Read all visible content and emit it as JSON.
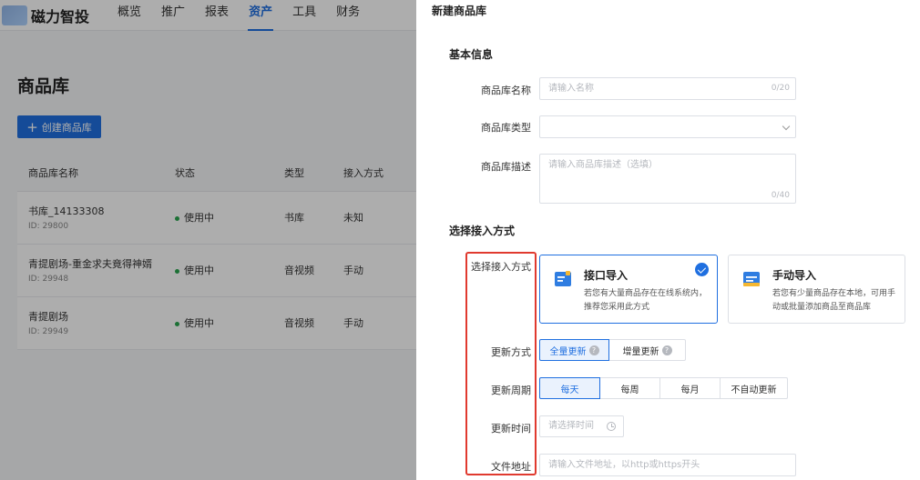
{
  "app": {
    "brand": "磁力智投",
    "nav": [
      "概览",
      "推广",
      "报表",
      "资产",
      "工具",
      "财务"
    ],
    "active_nav": "资产"
  },
  "page": {
    "title": "商品库",
    "create_button": "创建商品库",
    "columns": [
      "商品库名称",
      "状态",
      "类型",
      "接入方式"
    ],
    "rows": [
      {
        "name": "书库_14133308",
        "id": "ID: 29800",
        "status": "使用中",
        "type": "书库",
        "method": "未知"
      },
      {
        "name": "青提剧场-重金求夫竟得神婿",
        "id": "ID: 29948",
        "status": "使用中",
        "type": "音视频",
        "method": "手动"
      },
      {
        "name": "青提剧场",
        "id": "ID: 29949",
        "status": "使用中",
        "type": "音视频",
        "method": "手动"
      }
    ]
  },
  "drawer": {
    "title": "新建商品库",
    "basic_section": "基本信息",
    "name_label": "商品库名称",
    "name_placeholder": "请输入名称",
    "name_counter": "0/20",
    "type_label": "商品库类型",
    "desc_label": "商品库描述",
    "desc_placeholder": "请输入商品库描述（选填）",
    "desc_counter": "0/40",
    "access_section": "选择接入方式",
    "access_label": "选择接入方式",
    "cards": [
      {
        "title": "接口导入",
        "desc": "若您有大量商品存在在线系统内，推荐您采用此方式",
        "selected": true
      },
      {
        "title": "手动导入",
        "desc": "若您有少量商品存在本地，可用手动或批量添加商品至商品库",
        "selected": false
      }
    ],
    "update_mode_label": "更新方式",
    "update_modes": [
      "全量更新",
      "增量更新"
    ],
    "cycle_label": "更新周期",
    "cycles": [
      "每天",
      "每周",
      "每月",
      "不自动更新"
    ],
    "time_label": "更新时间",
    "time_placeholder": "请选择时间",
    "file_label": "文件地址",
    "file_placeholder": "请输入文件地址，以http或https开头"
  },
  "colors": {
    "primary": "#1f6fe0",
    "highlight": "#e03a2f",
    "status_green": "#2aa64f"
  }
}
